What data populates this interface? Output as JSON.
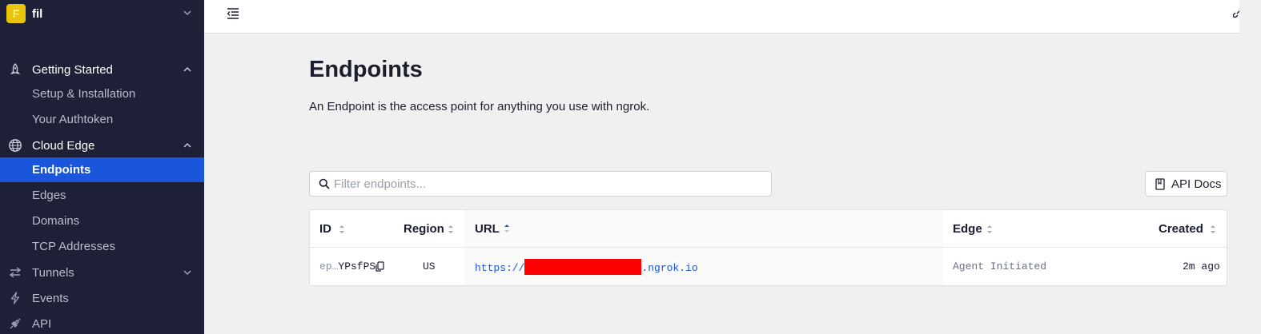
{
  "org": {
    "initial": "F",
    "name": "fil"
  },
  "sidebar": {
    "getting_started": {
      "label": "Getting Started",
      "items": [
        {
          "label": "Setup & Installation"
        },
        {
          "label": "Your Authtoken"
        }
      ]
    },
    "cloud_edge": {
      "label": "Cloud Edge",
      "items": [
        {
          "label": "Endpoints",
          "active": true
        },
        {
          "label": "Edges"
        },
        {
          "label": "Domains"
        },
        {
          "label": "TCP Addresses"
        }
      ]
    },
    "tunnels": {
      "label": "Tunnels"
    },
    "events": {
      "label": "Events"
    },
    "api": {
      "label": "API"
    }
  },
  "page": {
    "title": "Endpoints",
    "description": "An Endpoint is the access point for anything you use with ngrok."
  },
  "search": {
    "placeholder": "Filter endpoints...",
    "value": ""
  },
  "api_docs": {
    "label": "API Docs"
  },
  "table": {
    "columns": {
      "id": "ID",
      "region": "Region",
      "url": "URL",
      "edge": "Edge",
      "created": "Created"
    },
    "sorted_column": "URL",
    "sort_direction": "ascending",
    "rows": [
      {
        "id_prefix": "ep…",
        "id_suffix": "YPsfPS",
        "region": "US",
        "url_prefix": "https://",
        "url_suffix": ".ngrok.io",
        "edge": "Agent Initiated",
        "created": "2m ago"
      }
    ]
  },
  "colors": {
    "sidebar_bg": "#1e2037",
    "active_item": "#1a56db",
    "link": "#1a56db",
    "org_avatar": "#e8c40c",
    "redaction": "#ff0000"
  }
}
